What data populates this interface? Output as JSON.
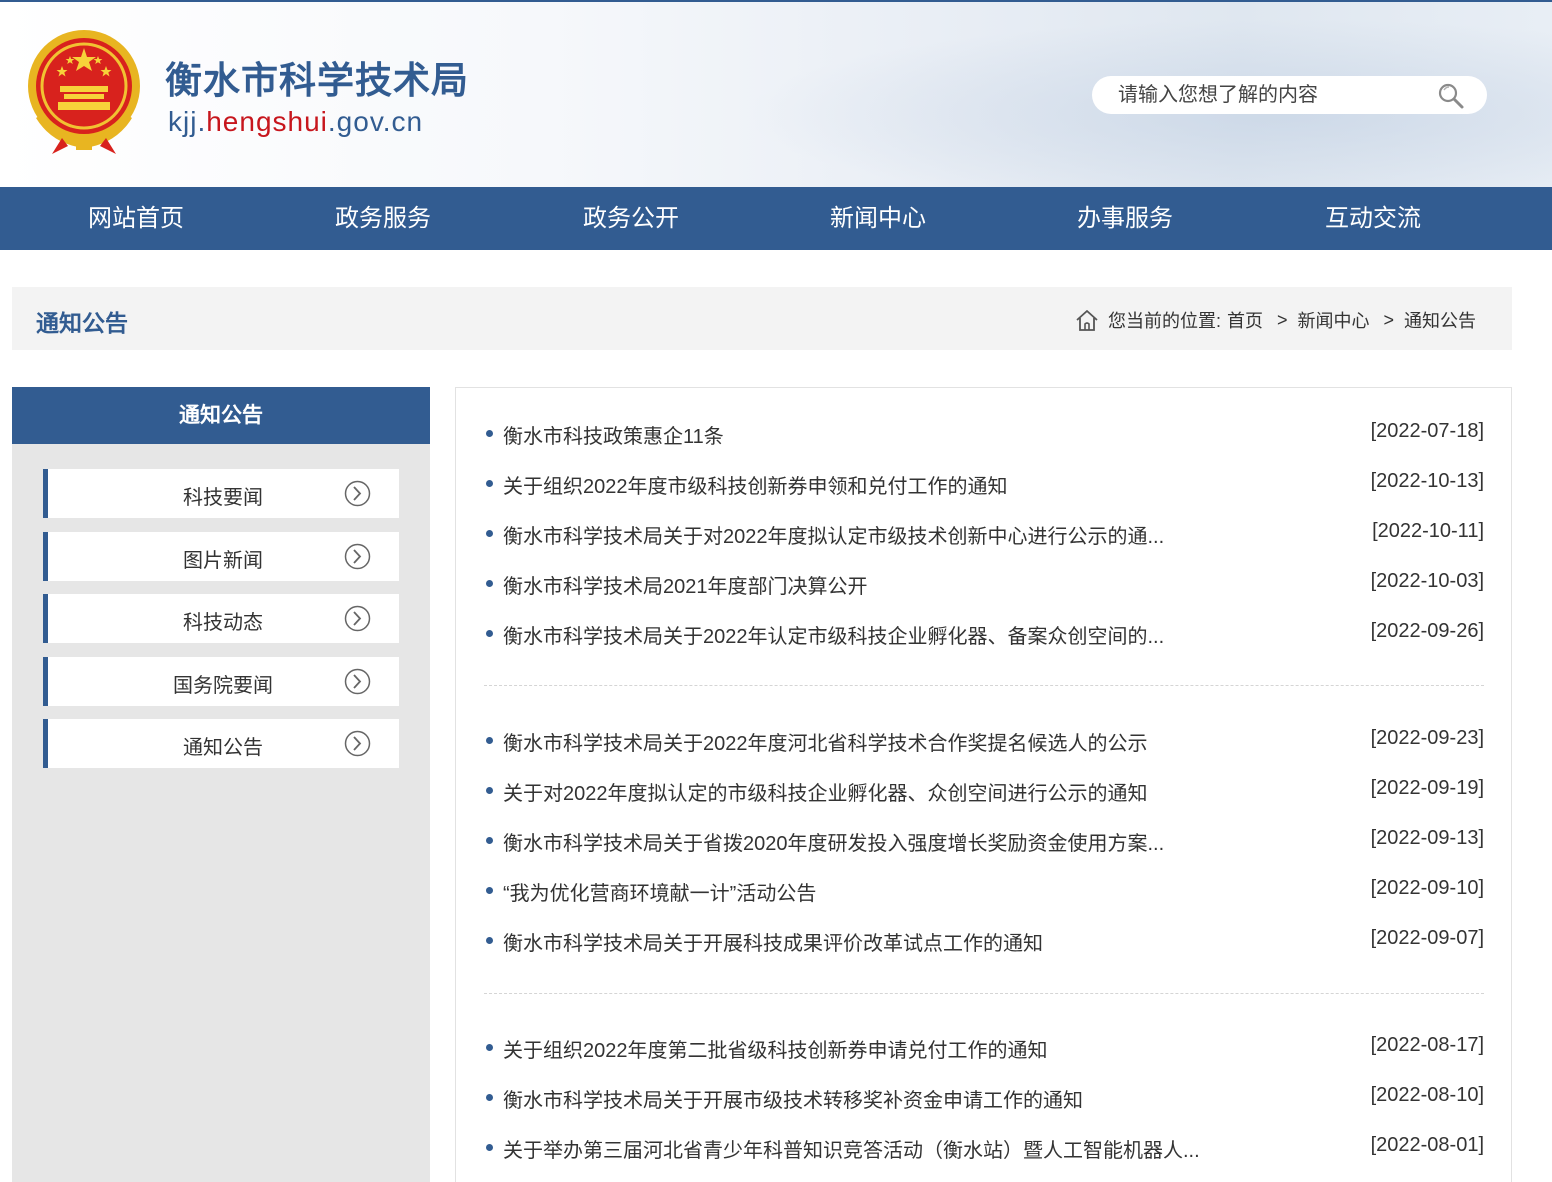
{
  "header": {
    "title": "衡水市科学技术局",
    "domain_pre": "kjj.",
    "domain_accent": "hengshui",
    "domain_post": ".gov.cn",
    "search_placeholder": "请输入您想了解的内容"
  },
  "nav": [
    "网站首页",
    "政务服务",
    "政务公开",
    "新闻中心",
    "办事服务",
    "互动交流"
  ],
  "page_title": "通知公告",
  "breadcrumb": {
    "prefix": "您当前的位置:",
    "items": [
      "首页",
      "新闻中心",
      "通知公告"
    ]
  },
  "sidebar": {
    "title": "通知公告",
    "items": [
      "科技要闻",
      "图片新闻",
      "科技动态",
      "国务院要闻",
      "通知公告"
    ]
  },
  "news": [
    {
      "title": "衡水市科技政策惠企11条",
      "date": "[2022-07-18]"
    },
    {
      "title": "关于组织2022年度市级科技创新券申领和兑付工作的通知",
      "date": "[2022-10-13]"
    },
    {
      "title": "衡水市科学技术局关于对2022年度拟认定市级技术创新中心进行公示的通...",
      "date": "[2022-10-11]"
    },
    {
      "title": "衡水市科学技术局2021年度部门决算公开",
      "date": "[2022-10-03]"
    },
    {
      "title": "衡水市科学技术局关于2022年认定市级科技企业孵化器、备案众创空间的...",
      "date": "[2022-09-26]"
    },
    {
      "title": "衡水市科学技术局关于2022年度河北省科学技术合作奖提名候选人的公示",
      "date": "[2022-09-23]"
    },
    {
      "title": "关于对2022年度拟认定的市级科技企业孵化器、众创空间进行公示的通知",
      "date": "[2022-09-19]"
    },
    {
      "title": "衡水市科学技术局关于省拨2020年度研发投入强度增长奖励资金使用方案...",
      "date": "[2022-09-13]"
    },
    {
      "title": "“我为优化营商环境献一计”活动公告",
      "date": "[2022-09-10]"
    },
    {
      "title": "衡水市科学技术局关于开展科技成果评价改革试点工作的通知",
      "date": "[2022-09-07]"
    },
    {
      "title": "关于组织2022年度第二批省级科技创新券申请兑付工作的通知",
      "date": "[2022-08-17]"
    },
    {
      "title": "衡水市科学技术局关于开展市级技术转移奖补资金申请工作的通知",
      "date": "[2022-08-10]"
    },
    {
      "title": "关于举办第三届河北省青少年科普知识竞答活动（衡水站）暨人工智能机器人...",
      "date": "[2022-08-01]"
    }
  ],
  "colors": {
    "primary": "#325c91",
    "accent": "#c7161d",
    "sidebar_bg": "#e6e6e6",
    "titlebar_bg": "#f3f3f3"
  }
}
